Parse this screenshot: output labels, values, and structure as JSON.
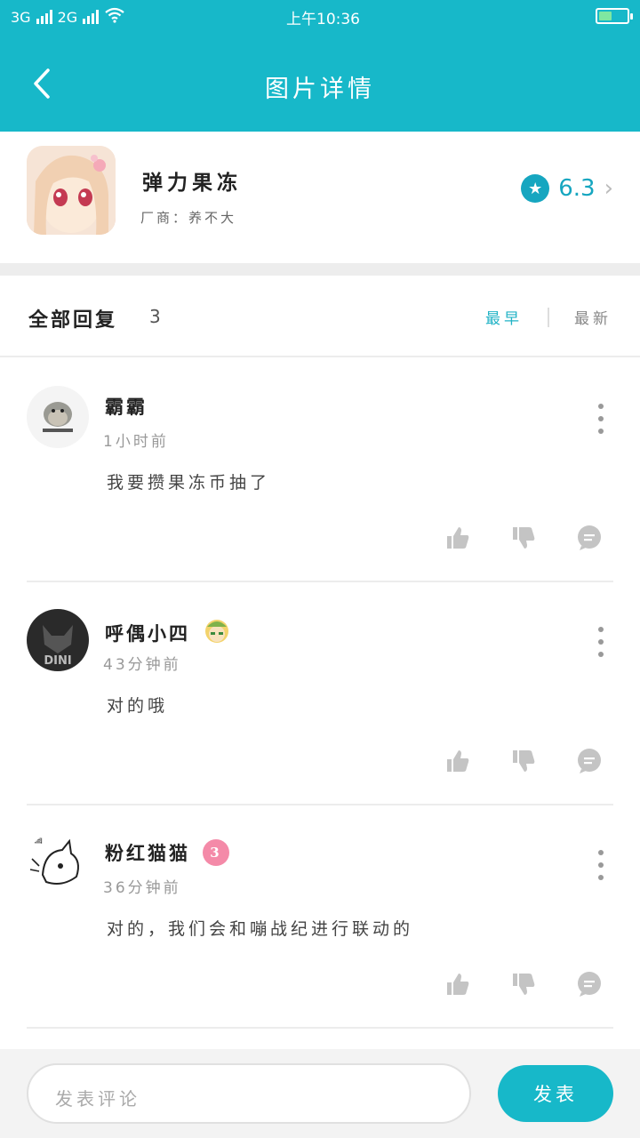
{
  "status_bar": {
    "network_1": "3G",
    "network_2": "2G",
    "network_3": "2G",
    "time": "上午10:36"
  },
  "header": {
    "title": "图片详情"
  },
  "app": {
    "name": "弹力果冻",
    "vendor": "厂商：",
    "vendor_name": "养不大",
    "rating": "6.3"
  },
  "replies": {
    "title": "全部回复",
    "count": "3",
    "sort_hottest": "最早",
    "sort_newest": "最新"
  },
  "comments": [
    {
      "user": "霸霸",
      "time": "1小时前",
      "text": "我要攒果冻币抽了"
    },
    {
      "user": "呼偶小四",
      "time": "43分钟前",
      "text": "对的哦"
    },
    {
      "user": "粉红猫猫",
      "time": "36分钟前",
      "text": "对的，我们会和嘣战纪进行联动的",
      "level_badge": "3"
    }
  ],
  "bottom": {
    "input_placeholder": "发表评论",
    "post_label": "发表"
  },
  "colors": {
    "accent": "#17b8c9",
    "star": "#16a6c0",
    "active_sort": "#22b3c6"
  }
}
